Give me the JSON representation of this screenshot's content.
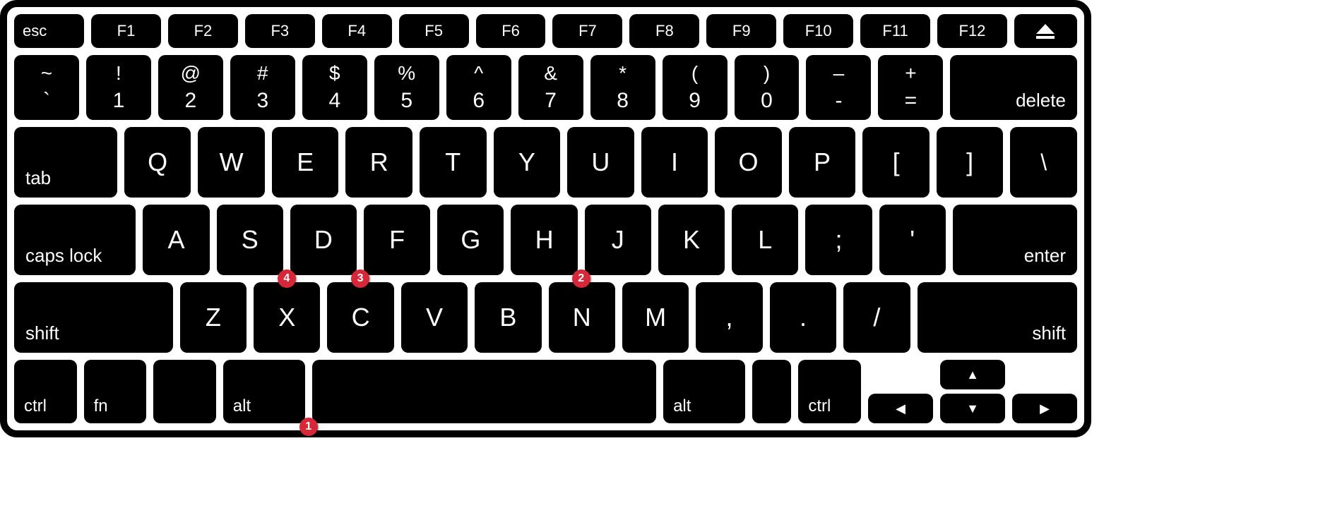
{
  "keyboard": {
    "fn_row": {
      "esc": "esc",
      "f": [
        "F1",
        "F2",
        "F3",
        "F4",
        "F5",
        "F6",
        "F7",
        "F8",
        "F9",
        "F10",
        "F11",
        "F12"
      ]
    },
    "num_row": [
      {
        "top": "~",
        "bot": "`"
      },
      {
        "top": "!",
        "bot": "1"
      },
      {
        "top": "@",
        "bot": "2"
      },
      {
        "top": "#",
        "bot": "3"
      },
      {
        "top": "$",
        "bot": "4"
      },
      {
        "top": "%",
        "bot": "5"
      },
      {
        "top": "^",
        "bot": "6"
      },
      {
        "top": "&",
        "bot": "7"
      },
      {
        "top": "*",
        "bot": "8"
      },
      {
        "top": "(",
        "bot": "9"
      },
      {
        "top": ")",
        "bot": "0"
      },
      {
        "top": "–",
        "bot": "-"
      },
      {
        "top": "+",
        "bot": "="
      }
    ],
    "delete": "delete",
    "tab": "tab",
    "q_row": [
      "Q",
      "W",
      "E",
      "R",
      "T",
      "Y",
      "U",
      "I",
      "O",
      "P",
      "[",
      "]",
      "\\"
    ],
    "caps": "caps lock",
    "a_row": [
      "A",
      "S",
      "D",
      "F",
      "G",
      "H",
      "J",
      "K",
      "L",
      ";",
      "'"
    ],
    "enter": "enter",
    "shift": "shift",
    "z_row": [
      "Z",
      "X",
      "C",
      "V",
      "B",
      "N",
      "M",
      ",",
      ".",
      "/"
    ],
    "bottom": {
      "ctrl": "ctrl",
      "fn": "fn",
      "alt": "alt"
    },
    "arrows": {
      "up": "▲",
      "down": "▼",
      "left": "◀",
      "right": "▶"
    }
  },
  "badges": [
    {
      "n": "1",
      "key": "alt-l"
    },
    {
      "n": "2",
      "key": "H"
    },
    {
      "n": "3",
      "key": "D"
    },
    {
      "n": "4",
      "key": "S"
    }
  ]
}
